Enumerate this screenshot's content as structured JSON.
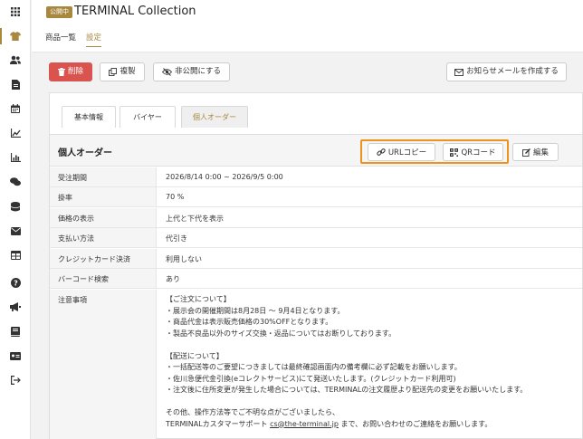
{
  "header": {
    "status_badge": "公開中",
    "title": "TERMINAL Collection"
  },
  "nav": {
    "tab_products": "商品一覧",
    "tab_settings": "設定"
  },
  "toolbar": {
    "delete": "削除",
    "duplicate": "複製",
    "unpublish": "非公開にする",
    "create_mail": "お知らせメールを作成する"
  },
  "tabs": {
    "basic": "基本情報",
    "buyer": "バイヤー",
    "personal": "個人オーダー"
  },
  "panel": {
    "title": "個人オーダー",
    "url_copy": "URLコピー",
    "qr_code": "QRコード",
    "edit": "編集"
  },
  "details": {
    "period_label": "受注期間",
    "period_value": "2026/8/14 0:00 ~ 2026/9/5 0:00",
    "rate_label": "掛率",
    "rate_value": "70 %",
    "price_label": "価格の表示",
    "price_value": "上代と下代を表示",
    "payment_label": "支払い方法",
    "payment_value": "代引き",
    "credit_label": "クレジットカード決済",
    "credit_value": "利用しない",
    "barcode_label": "バーコード検索",
    "barcode_value": "あり",
    "notes_label": "注意事項"
  },
  "notes": {
    "l1": "【ご注文について】",
    "l2": "・展示会の開催期間は8月28日 〜 9月4日となります。",
    "l3": "・商品代金は表示販売価格の30%OFFとなります。",
    "l4": "・製品不良品以外のサイズ交換・返品についてはお断りしております。",
    "l5": "【配送について】",
    "l6": "・一括配送等のご要望につきましては最終確認画面内の備考欄に必ず記載をお願いします。",
    "l7": "・佐川急便代金引換(eコレクトサービス)にて発送いたします。(クレジットカード利用可)",
    "l8": "・注文後に住所変更が発生した場合については、TERMINALの注文履歴より配送先の変更をお願いいたします。",
    "l9": "その他、操作方法等でご不明な点がございましたら、",
    "l10_pre": "TERMINALカスタマーサポート ",
    "l10_email": "cs@the-terminal.jp",
    "l10_post": " まで、お問い合わせのご連絡をお願いします。"
  },
  "icons": {
    "sidebar": [
      "grid-icon",
      "shirt-icon",
      "users-icon",
      "document-icon",
      "calendar-icon",
      "trend-icon",
      "bar-chart-icon",
      "chat-icon",
      "database-icon",
      "mail-icon",
      "table-icon",
      "help-icon",
      "megaphone-icon",
      "book-icon",
      "id-card-icon",
      "logout-icon"
    ]
  },
  "colors": {
    "accent": "#a8873f",
    "danger": "#d9534f",
    "highlight": "#f0921e"
  }
}
